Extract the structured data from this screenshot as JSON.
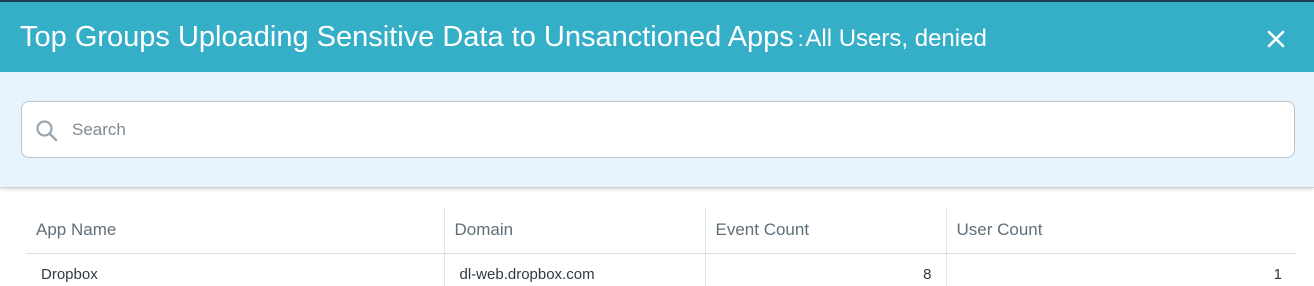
{
  "dialog": {
    "title": "Top Groups Uploading Sensitive Data  to Unsanctioned Apps",
    "separator": ":",
    "subtitle": "All Users, denied",
    "close_icon": "close-icon"
  },
  "search": {
    "placeholder": "Search",
    "value": "",
    "icon": "search-icon"
  },
  "table": {
    "headers": [
      "App Name",
      "Domain",
      "Event Count",
      "User Count"
    ],
    "rows": [
      {
        "app_name": "Dropbox",
        "domain": "dl-web.dropbox.com",
        "event_count": "8",
        "user_count": "1"
      }
    ]
  },
  "colors": {
    "header_bg": "#35aec8",
    "filter_bg": "#e8f4fd",
    "text": "#2e3a42"
  }
}
